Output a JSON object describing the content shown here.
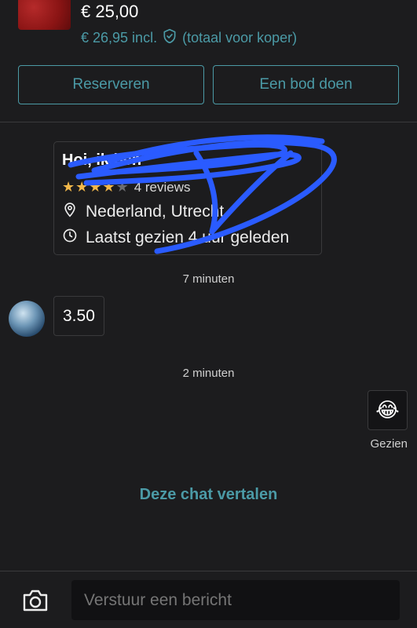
{
  "listing": {
    "price": "€ 25,00",
    "price_incl": "€ 26,95 incl.",
    "price_note": "(totaal voor koper)",
    "icons": {
      "shield": "shield-check-icon"
    }
  },
  "actions": {
    "reserve_label": "Reserveren",
    "bid_label": "Een bod doen"
  },
  "profile": {
    "greeting": "Hoi, ik ben",
    "rating": 4,
    "rating_max": 5,
    "reviews": "4 reviews",
    "location": "Nederland, Utrecht",
    "last_seen": "Laatst gezien 4 uur geleden"
  },
  "chat": {
    "messages": [
      {
        "timestamp": "7 minuten",
        "direction": "incoming",
        "text": "3.50"
      },
      {
        "timestamp": "2 minuten",
        "direction": "outgoing",
        "text": "😂",
        "status": "Gezien"
      }
    ],
    "translate_label": "Deze chat vertalen"
  },
  "composer": {
    "placeholder": "Verstuur een bericht",
    "camera_icon": "camera-icon"
  },
  "colors": {
    "accent": "#4b9aa6",
    "background": "#1c1c1e",
    "star": "#f3b84a",
    "scribble": "#2a5bff"
  }
}
